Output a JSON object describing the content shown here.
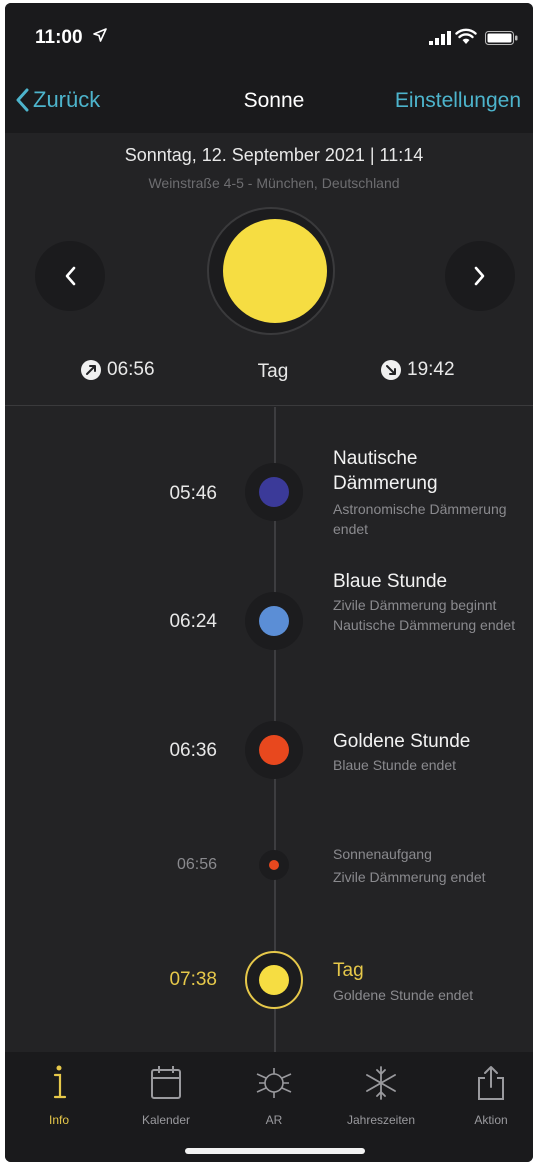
{
  "status": {
    "time": "11:00"
  },
  "nav": {
    "back_label": "Zurück",
    "title": "Sonne",
    "settings_label": "Einstellungen"
  },
  "header": {
    "date": "Sonntag, 12. September 2021 | 11:14",
    "address": "Weinstraße 4-5 - München, Deutschland"
  },
  "sun": {
    "sunrise": "06:56",
    "phase": "Tag",
    "sunset": "19:42",
    "color": "#f6dd42"
  },
  "events": [
    {
      "time": "05:46",
      "name": "Nautische Dämmerung",
      "sub": "Astronomische Dämmerung endet",
      "color": "#3b3a99"
    },
    {
      "time": "06:24",
      "name": "Blaue Stunde",
      "sub": "Zivile Dämmerung beginnt Nautische Dämmerung endet",
      "color": "#5b8ed6"
    },
    {
      "time": "06:36",
      "name": "Goldene Stunde",
      "sub": "Blaue Stunde endet",
      "color": "#e8481e"
    },
    {
      "time": "06:56",
      "name": "Sonnenaufgang",
      "sub": "Zivile Dämmerung endet",
      "color": "#e8481e"
    },
    {
      "time": "07:38",
      "name": "Tag",
      "sub": "Goldene Stunde endet",
      "color": "#f6dd42"
    }
  ],
  "tabs": [
    {
      "label": "Info",
      "icon": "info-icon"
    },
    {
      "label": "Kalender",
      "icon": "calendar-icon"
    },
    {
      "label": "AR",
      "icon": "ar-icon"
    },
    {
      "label": "Jahreszeiten",
      "icon": "snowflake-icon"
    },
    {
      "label": "Aktion",
      "icon": "share-icon"
    }
  ],
  "colors": {
    "accent": "#4db4cc",
    "active_tab": "#e6c84a",
    "background": "#232325"
  }
}
